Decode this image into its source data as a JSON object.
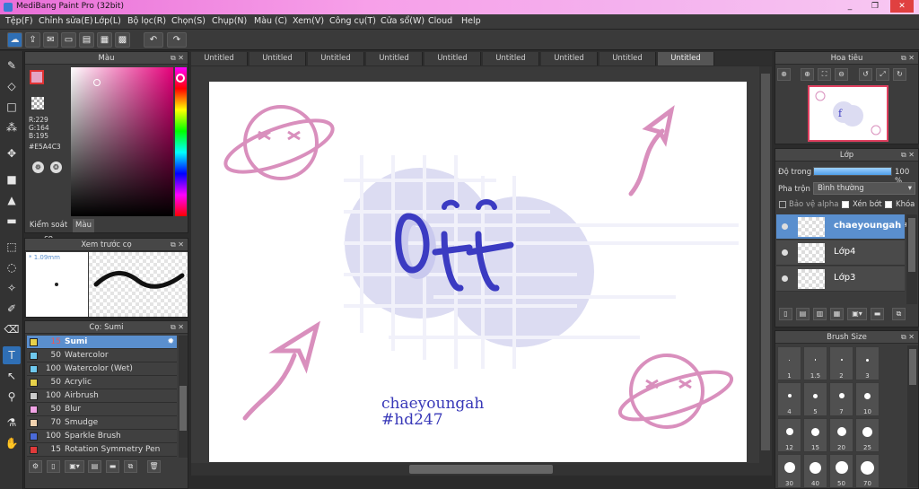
{
  "window": {
    "title": "MediBang Paint Pro (32bit)",
    "min": "_",
    "max": "❐",
    "close": "✕"
  },
  "menu": [
    "Tệp(F)",
    "Chỉnh sửa(E)",
    "Lớp(L)",
    "Bộ lọc(R)",
    "Chọn(S)",
    "Chụp(N)",
    "Màu (C)",
    "Xem(V)",
    "Công cụ(T)",
    "Cửa sổ(W)",
    "Cloud",
    "Help"
  ],
  "color_panel": {
    "title": "Màu",
    "r": "R:229",
    "g": "G:164",
    "b": "B:195",
    "hex": "#E5A4C3",
    "tab_brush_control": "Kiểm soát cọ",
    "tab_color": "Màu",
    "primary_color": "#e5a4c3"
  },
  "brush_preview": {
    "title": "Xem trước cọ",
    "size": "* 1.09mm"
  },
  "brush_list": {
    "title": "Cọ: Sumi",
    "items": [
      {
        "size": "15",
        "name": "Sumi",
        "color": "#e8d24a"
      },
      {
        "size": "50",
        "name": "Watercolor",
        "color": "#6fc9ee"
      },
      {
        "size": "100",
        "name": "Watercolor (Wet)",
        "color": "#6fc9ee"
      },
      {
        "size": "50",
        "name": "Acrylic",
        "color": "#e8d24a"
      },
      {
        "size": "100",
        "name": "Airbrush",
        "color": "#cccccc"
      },
      {
        "size": "50",
        "name": "Blur",
        "color": "#f2a4e6"
      },
      {
        "size": "70",
        "name": "Smudge",
        "color": "#f2d3b0"
      },
      {
        "size": "100",
        "name": "Sparkle Brush",
        "color": "#4a6ad8"
      },
      {
        "size": "15",
        "name": "Rotation Symmetry Pen",
        "color": "#e03a3a"
      }
    ]
  },
  "tabs": [
    "Untitled",
    "Untitled",
    "Untitled",
    "Untitled",
    "Untitled",
    "Untitled",
    "Untitled",
    "Untitled",
    "Untitled"
  ],
  "canvas": {
    "text_line1": "chaeyoungah",
    "text_line2": "#hd247",
    "art_text": "Off"
  },
  "navigator": {
    "title": "Hoa tiêu"
  },
  "layer_panel": {
    "title": "Lớp",
    "opacity_label": "Độ trong",
    "opacity_value": "100 %",
    "opacity_fraction": 1.0,
    "blend_label": "Pha trộn",
    "blend_value": "Bình thường",
    "protect_alpha": "Bảo vệ alpha",
    "clip": "Xén bớt",
    "lock": "Khóa",
    "layers": [
      "chaeyoungah",
      "Lớp4",
      "Lớp3"
    ]
  },
  "brush_size": {
    "title": "Brush Size",
    "sizes": [
      "1",
      "1.5",
      "2",
      "3",
      "4",
      "5",
      "7",
      "10",
      "12",
      "15",
      "20",
      "25",
      "30",
      "40",
      "50",
      "70"
    ]
  }
}
